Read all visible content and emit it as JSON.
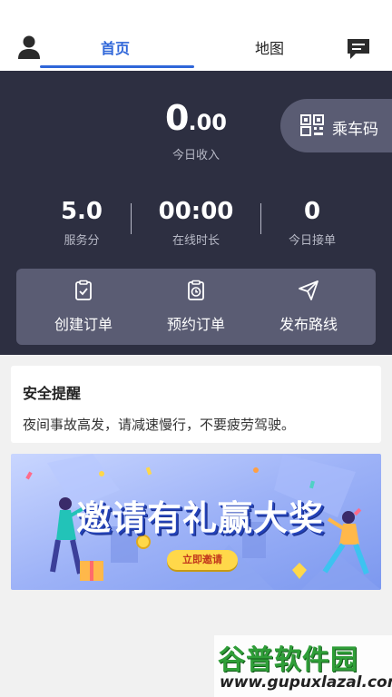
{
  "nav": {
    "tabs": [
      {
        "label": "首页",
        "active": true
      },
      {
        "label": "地图",
        "active": false
      }
    ],
    "left_icon": "user-icon",
    "right_icon": "message-icon",
    "accent": "#2f66d9"
  },
  "dashboard": {
    "background": "#2d2f41",
    "income_int": "0",
    "income_dec": ".00",
    "income_label": "今日收入",
    "ride_code_label": "乘车码",
    "stats": [
      {
        "value": "5.0",
        "label": "服务分"
      },
      {
        "value": "00:00",
        "label": "在线时长"
      },
      {
        "value": "0",
        "label": "今日接单"
      }
    ],
    "actions": [
      {
        "label": "创建订单",
        "icon": "clipboard-check-icon"
      },
      {
        "label": "预约订单",
        "icon": "clipboard-clock-icon"
      },
      {
        "label": "发布路线",
        "icon": "send-icon"
      }
    ]
  },
  "safety": {
    "title": "安全提醒",
    "text": "夜间事故高发，请减速慢行，不要疲劳驾驶。"
  },
  "banner": {
    "title": "邀请有礼赢大奖",
    "button": "立即邀请"
  },
  "watermark": {
    "logo": "谷普软件园",
    "url": "www.gupuxlazal.com"
  }
}
